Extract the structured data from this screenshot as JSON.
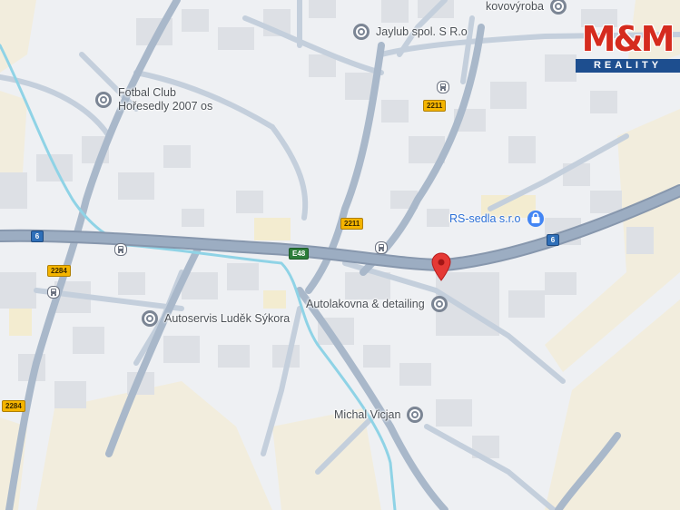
{
  "map": {
    "colors": {
      "background": "#eef0f3",
      "road": "#c4cfdc",
      "major_road": "#97a9bf",
      "water": "#8fd3e6",
      "building": "#dde0e5",
      "field": "#f2eddd",
      "pin": "#e53935"
    },
    "pois": [
      {
        "id": "jaylub",
        "label": "Jaylub spol. S R.o",
        "icon": "place-pin-icon"
      },
      {
        "id": "kovovyroba",
        "label": "kovovýroba",
        "icon": "place-pin-icon"
      },
      {
        "id": "fotbal",
        "label_line1": "Fotbal Club",
        "label_line2": "Hořesedly 2007 os",
        "icon": "place-pin-icon"
      },
      {
        "id": "rs-sedla",
        "label": "RS-sedla s.r.o",
        "icon": "shopping-bag-icon"
      },
      {
        "id": "autolakovna",
        "label": "Autolakovna & detailing",
        "icon": "place-pin-icon"
      },
      {
        "id": "autoservis",
        "label": "Autoservis Luděk Sýkora",
        "icon": "place-pin-icon"
      },
      {
        "id": "michal",
        "label": "Michal Vicjan",
        "icon": "place-pin-icon"
      }
    ],
    "road_shields": [
      {
        "id": "r2211a",
        "label": "2211",
        "type": "route"
      },
      {
        "id": "r2211b",
        "label": "2211",
        "type": "route"
      },
      {
        "id": "r2284a",
        "label": "2284",
        "type": "route"
      },
      {
        "id": "r2284b",
        "label": "2284",
        "type": "route"
      },
      {
        "id": "r6a",
        "label": "6",
        "type": "national"
      },
      {
        "id": "r6b",
        "label": "6",
        "type": "national"
      },
      {
        "id": "e48",
        "label": "E48",
        "type": "european"
      }
    ],
    "bus_stops": [
      "bus-stop-icon",
      "bus-stop-icon",
      "bus-stop-icon",
      "bus-stop-icon"
    ],
    "selected_marker": "location-pin-icon"
  },
  "logo": {
    "brand": "M&M",
    "sub": "REALITY"
  }
}
